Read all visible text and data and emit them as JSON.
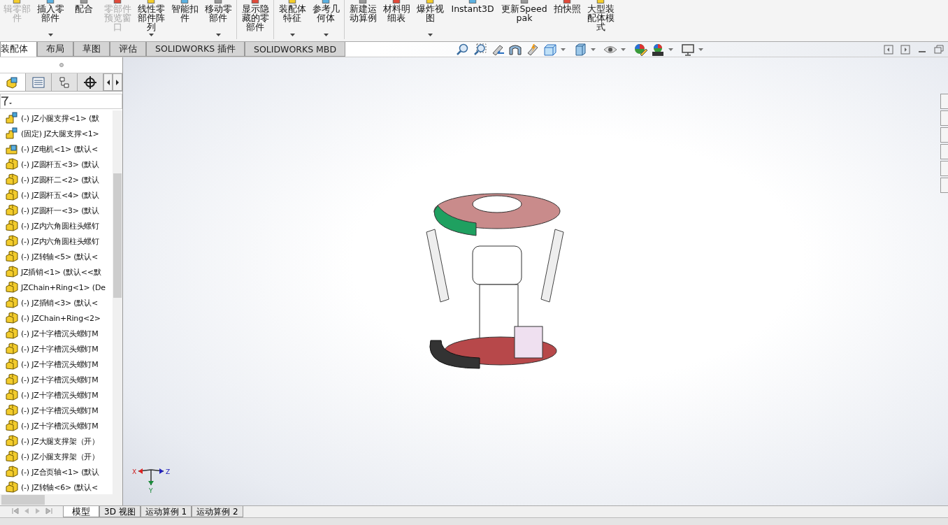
{
  "ribbon": {
    "buttons": [
      {
        "label": "辑零部件",
        "disabled": true,
        "dropdown": false
      },
      {
        "label": "插入零部件",
        "disabled": false,
        "dropdown": true
      },
      {
        "label": "配合",
        "disabled": false,
        "dropdown": false
      },
      {
        "label": "零部件预览窗口",
        "disabled": true,
        "dropdown": false
      },
      {
        "label": "线性零部件阵列",
        "disabled": false,
        "dropdown": true
      },
      {
        "label": "智能扣件",
        "disabled": false,
        "dropdown": false
      },
      {
        "label": "移动零部件",
        "disabled": false,
        "dropdown": true
      },
      {
        "label": "显示隐藏的零部件",
        "disabled": false,
        "dropdown": false
      },
      {
        "label": "装配体特征",
        "disabled": false,
        "dropdown": true
      },
      {
        "label": "参考几何体",
        "disabled": false,
        "dropdown": true
      },
      {
        "label": "新建运动算例",
        "disabled": false,
        "dropdown": false
      },
      {
        "label": "材料明细表",
        "disabled": false,
        "dropdown": false
      },
      {
        "label": "爆炸视图",
        "disabled": false,
        "dropdown": true
      },
      {
        "label": "Instant3D",
        "disabled": false,
        "dropdown": false
      },
      {
        "label": "更新Speedpak",
        "disabled": false,
        "dropdown": false
      },
      {
        "label": "拍快照",
        "disabled": false,
        "dropdown": false
      },
      {
        "label": "大型装配体模式",
        "disabled": false,
        "dropdown": false
      }
    ]
  },
  "command_tabs": [
    {
      "label": "装配体",
      "selected": true
    },
    {
      "label": "布局",
      "selected": false
    },
    {
      "label": "草图",
      "selected": false
    },
    {
      "label": "评估",
      "selected": false
    },
    {
      "label": "SOLIDWORKS 插件",
      "selected": false
    },
    {
      "label": "SOLIDWORKS MBD",
      "selected": false
    }
  ],
  "feature_tree": {
    "items": [
      {
        "label": "(-) JZ小腿支撑<1> (默",
        "kind": "subassembly"
      },
      {
        "label": "(固定) JZ大腿支撑<1>",
        "kind": "subassembly"
      },
      {
        "label": "(-) JZ电机<1> (默认<",
        "kind": "assembly"
      },
      {
        "label": "(-) JZ圆杆五<3> (默认",
        "kind": "part"
      },
      {
        "label": "(-) JZ圆杆二<2> (默认",
        "kind": "part"
      },
      {
        "label": "(-) JZ圆杆五<4> (默认",
        "kind": "part"
      },
      {
        "label": "(-) JZ圆杆一<3> (默认",
        "kind": "part"
      },
      {
        "label": "(-) JZ内六角圆柱头螺钉",
        "kind": "part"
      },
      {
        "label": "(-) JZ内六角圆柱头螺钉",
        "kind": "part"
      },
      {
        "label": "(-) JZ转轴<5> (默认<",
        "kind": "part"
      },
      {
        "label": "JZ插销<1> (默认<<默",
        "kind": "part"
      },
      {
        "label": "JZChain+Ring<1> (De",
        "kind": "part"
      },
      {
        "label": "(-) JZ插销<3> (默认<",
        "kind": "part"
      },
      {
        "label": "(-) JZChain+Ring<2>",
        "kind": "part"
      },
      {
        "label": "(-) JZ十字槽沉头螺钉M",
        "kind": "part"
      },
      {
        "label": "(-) JZ十字槽沉头螺钉M",
        "kind": "part"
      },
      {
        "label": "(-) JZ十字槽沉头螺钉M",
        "kind": "part"
      },
      {
        "label": "(-) JZ十字槽沉头螺钉M",
        "kind": "part"
      },
      {
        "label": "(-) JZ十字槽沉头螺钉M",
        "kind": "part"
      },
      {
        "label": "(-) JZ十字槽沉头螺钉M",
        "kind": "part"
      },
      {
        "label": "(-) JZ十字槽沉头螺钉M",
        "kind": "part"
      },
      {
        "label": "(-) JZ大腿支撑架（开）",
        "kind": "part"
      },
      {
        "label": "(-) JZ小腿支撑架（开）",
        "kind": "part"
      },
      {
        "label": "(-) JZ合页轴<1> (默认",
        "kind": "part"
      },
      {
        "label": "(-) JZ转轴<6> (默认<",
        "kind": "part"
      }
    ]
  },
  "panel_tabs": [
    {
      "kind": "feature",
      "selected": true
    },
    {
      "kind": "property",
      "selected": false
    },
    {
      "kind": "config",
      "selected": false
    },
    {
      "kind": "target",
      "selected": false
    }
  ],
  "triad": {
    "x": "X",
    "y": "Y",
    "z": "Z"
  },
  "bottom_tabs": [
    {
      "label": "模型",
      "selected": true
    },
    {
      "label": "3D 视图",
      "selected": false
    },
    {
      "label": "运动算例 1",
      "selected": false
    },
    {
      "label": "运动算例 2",
      "selected": false
    }
  ]
}
